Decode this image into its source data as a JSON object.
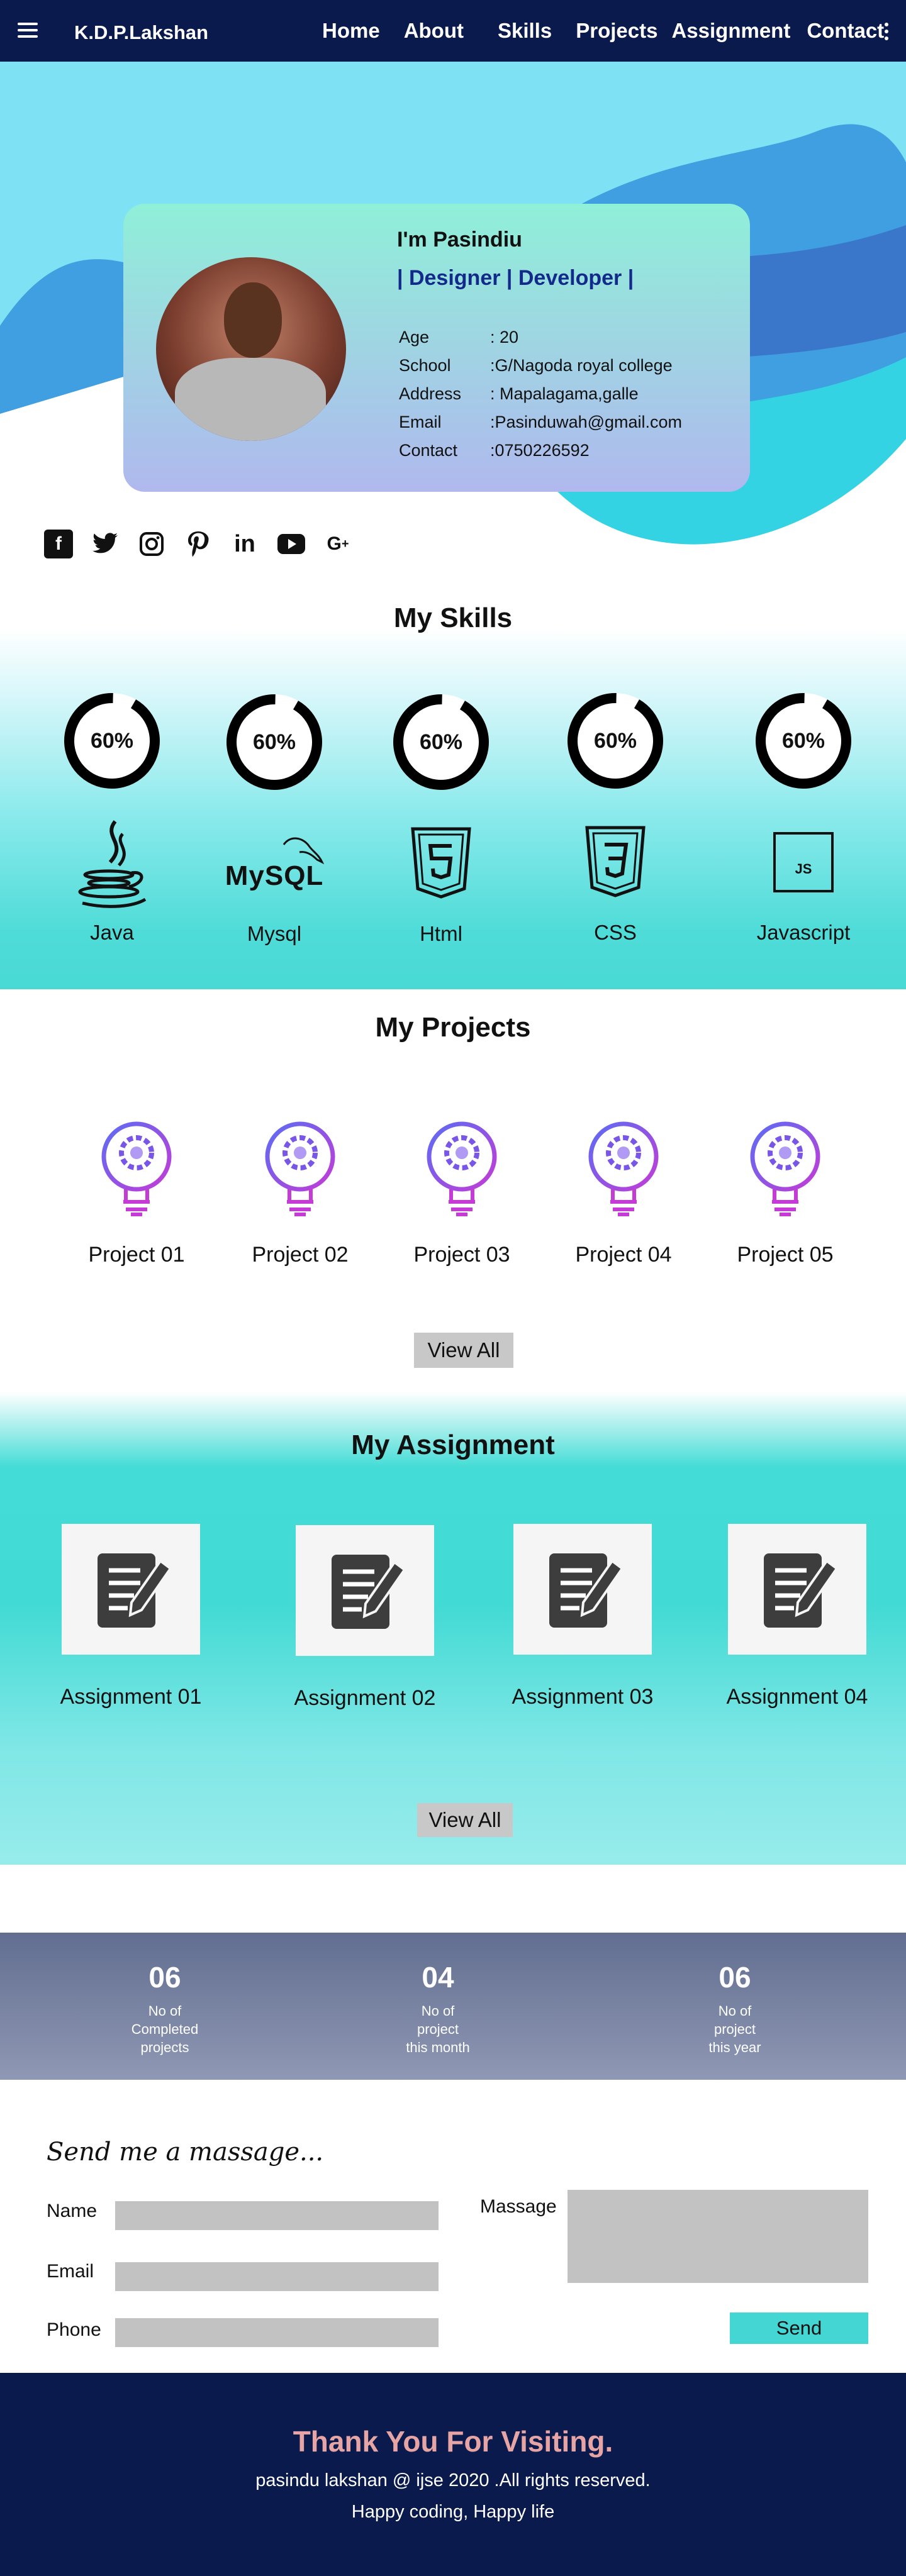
{
  "nav": {
    "brand": "K.D.P.Lakshan",
    "links": [
      "Home",
      "About",
      "Skills",
      "Projects",
      "Assignment",
      "Contact"
    ]
  },
  "profile": {
    "greeting": "I'm Pasindiu",
    "role": "| Designer | Developer |",
    "details": [
      {
        "key": "Age",
        "value": ": 20"
      },
      {
        "key": "School",
        "value": ":G/Nagoda royal college"
      },
      {
        "key": "Address",
        "value": ": Mapalagama,galle"
      },
      {
        "key": "Email",
        "value": ":Pasinduwah@gmail.com"
      },
      {
        "key": "Contact",
        "value": ":0750226592"
      }
    ]
  },
  "social": [
    "facebook-icon",
    "twitter-icon",
    "instagram-icon",
    "pinterest-icon",
    "linkedin-icon",
    "youtube-icon",
    "google-plus-icon"
  ],
  "skills": {
    "title": "My Skills",
    "items": [
      {
        "name": "Java",
        "percent": "60%",
        "level": 0.6
      },
      {
        "name": "Mysql",
        "percent": "60%",
        "level": 0.6
      },
      {
        "name": "Html",
        "percent": "60%",
        "level": 0.6
      },
      {
        "name": "CSS",
        "percent": "60%",
        "level": 0.6
      },
      {
        "name": "Javascript",
        "percent": "60%",
        "level": 0.6
      }
    ],
    "js_logo_text": "JS",
    "mysql_logo_text": "MySQL"
  },
  "projects": {
    "title": "My Projects",
    "items": [
      "Project 01",
      "Project 02",
      "Project 03",
      "Project 04",
      "Project 05"
    ],
    "view_all": "View All"
  },
  "assignments": {
    "title": "My Assignment",
    "items": [
      "Assignment 01",
      "Assignment 02",
      "Assignment 03",
      "Assignment 04"
    ],
    "view_all": "View All"
  },
  "stats": [
    {
      "num": "06",
      "label": [
        "No of",
        "Completed",
        "projects"
      ]
    },
    {
      "num": "04",
      "label": [
        "No of",
        "project",
        "this month"
      ]
    },
    {
      "num": "06",
      "label": [
        "No of",
        "project",
        "this year"
      ]
    }
  ],
  "contact": {
    "title": "Send me a massage...",
    "name_label": "Name",
    "email_label": "Email",
    "phone_label": "Phone",
    "message_label": "Massage",
    "send": "Send"
  },
  "footer": {
    "thanks": "Thank You For Visiting.",
    "copyright": "pasindu lakshan @ ijse 2020 .All rights reserved.",
    "motto": "Happy coding,  Happy life"
  },
  "colors": {
    "nav": "#0b1a4d",
    "accent_teal": "#44d6d2",
    "role_blue": "#132a8a",
    "thanks_pink": "#e7a4a4"
  }
}
